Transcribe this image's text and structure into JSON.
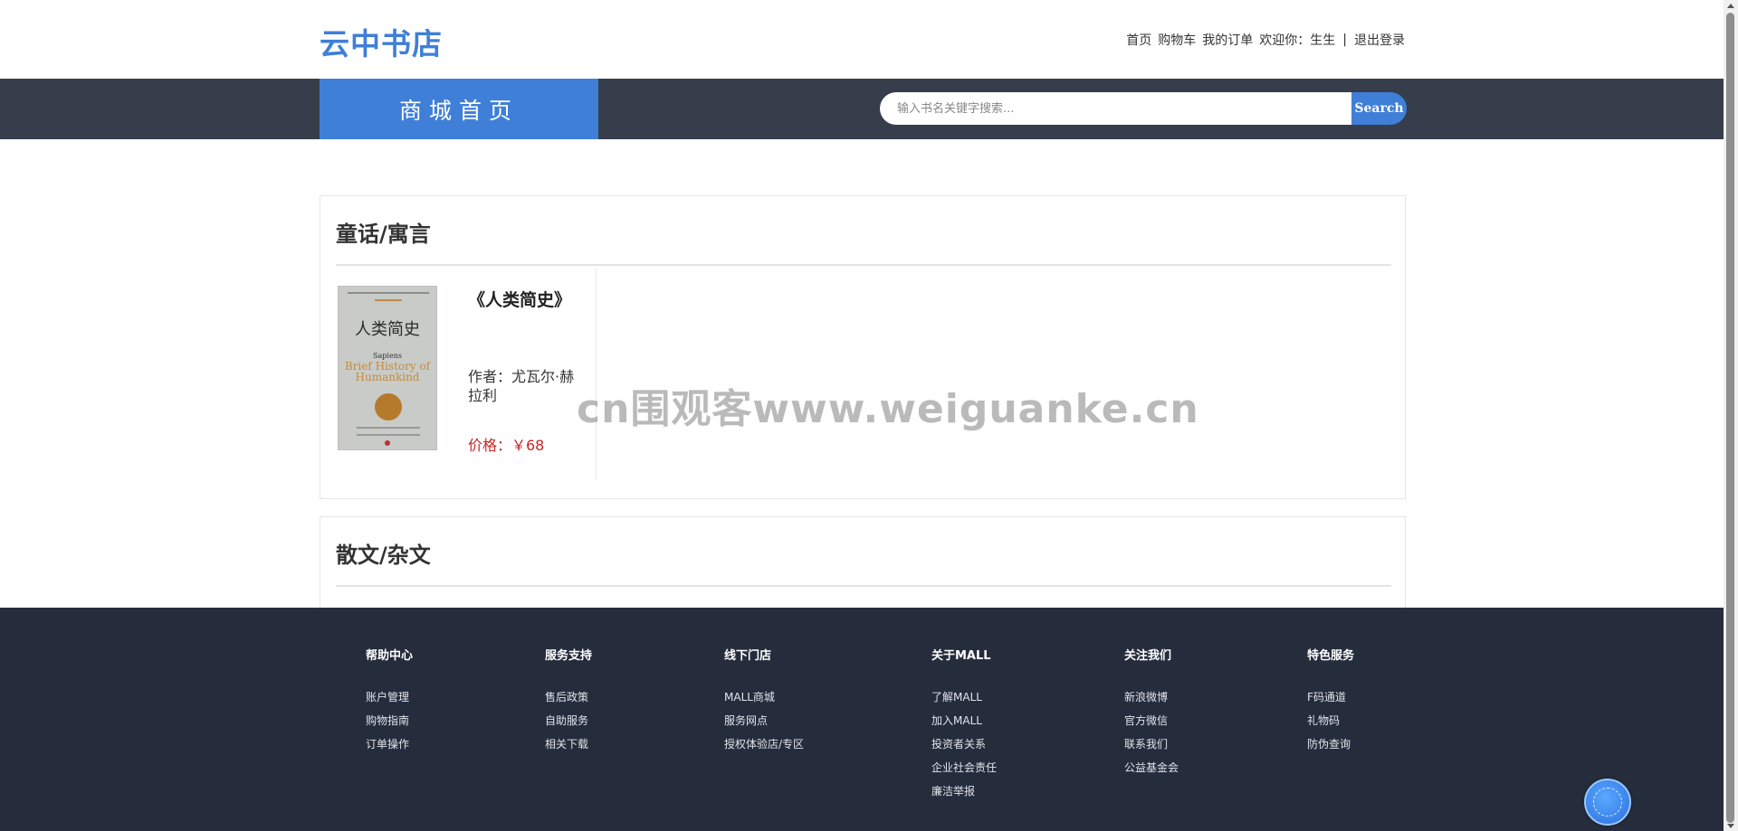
{
  "header": {
    "logo": "云中书店",
    "nav": {
      "home": "首页",
      "cart": "购物车",
      "orders": "我的订单",
      "welcome": "欢迎你：",
      "username": "生生",
      "separator": "|",
      "logout": "退出登录"
    }
  },
  "navbar": {
    "home_tab": "商城首页",
    "search": {
      "placeholder": "输入书名关键字搜索...",
      "button": "Search"
    }
  },
  "sections": [
    {
      "title": "童话/寓言",
      "books": [
        {
          "title": "《人类简史》",
          "author": "作者：尤瓦尔·赫拉利",
          "price": "价格：￥68",
          "cover": {
            "title": "人类简史",
            "subtitle": "Sapiens",
            "english": "Brief History of Humankind"
          }
        }
      ]
    },
    {
      "title": "散文/杂文",
      "books": []
    }
  ],
  "watermark": "cn围观客www.weiguanke.cn",
  "footer": {
    "columns": [
      {
        "title": "帮助中心",
        "items": [
          "账户管理",
          "购物指南",
          "订单操作"
        ]
      },
      {
        "title": "服务支持",
        "items": [
          "售后政策",
          "自助服务",
          "相关下载"
        ]
      },
      {
        "title": "线下门店",
        "items": [
          "MALL商城",
          "服务网点",
          "授权体验店/专区"
        ]
      },
      {
        "title": "关于MALL",
        "items": [
          "了解MALL",
          "加入MALL",
          "投资者关系",
          "企业社会责任",
          "廉洁举报"
        ]
      },
      {
        "title": "关注我们",
        "items": [
          "新浪微博",
          "官方微信",
          "联系我们",
          "公益基金会"
        ]
      },
      {
        "title": "特色服务",
        "items": [
          "F码通道",
          "礼物码",
          "防伪查询"
        ]
      }
    ]
  },
  "colors": {
    "brand_blue": "#3f7fd8",
    "navbar_bg": "#363e4b",
    "footer_bg": "#252d3d",
    "price_red": "#c82626"
  }
}
